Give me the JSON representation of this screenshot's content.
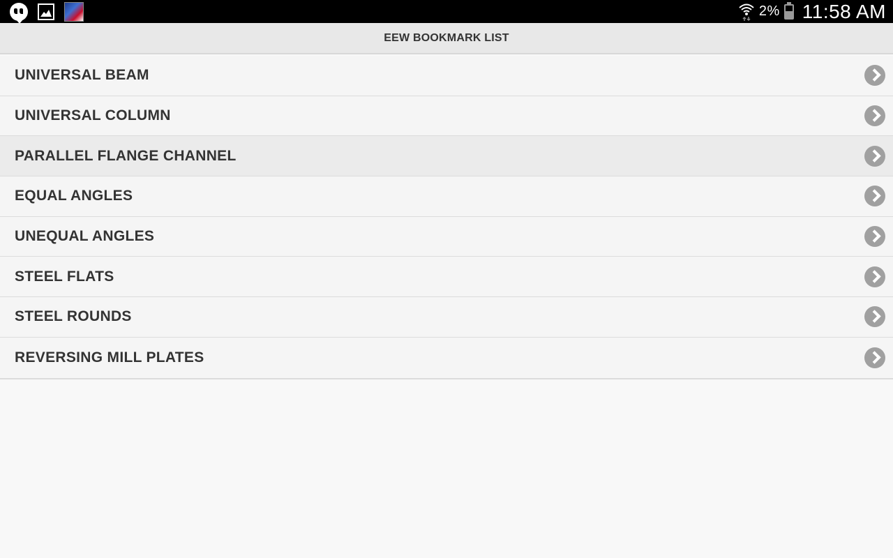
{
  "status_bar": {
    "left_icons": [
      "hangouts-icon",
      "gallery-icon",
      "app-thumbnail-icon"
    ],
    "right_icons": [
      "wifi-icon",
      "battery-icon"
    ],
    "battery_percent": "2%",
    "time": "11:58 AM"
  },
  "header": {
    "title": "EEW BOOKMARK LIST"
  },
  "bookmarks": {
    "items": [
      {
        "label": "UNIVERSAL BEAM"
      },
      {
        "label": "UNIVERSAL COLUMN"
      },
      {
        "label": "PARALLEL FLANGE CHANNEL"
      },
      {
        "label": "EQUAL ANGLES"
      },
      {
        "label": "UNEQUAL ANGLES"
      },
      {
        "label": "STEEL FLATS"
      },
      {
        "label": "STEEL ROUNDS"
      },
      {
        "label": "REVERSING MILL PLATES"
      }
    ],
    "chevron_icon": "chevron-right-icon"
  },
  "colors": {
    "status_bar": "#000000",
    "title_bar": "#e8e8e8",
    "list_background": "#f5f5f5",
    "text": "#333333",
    "chevron": "#a0a0a0"
  }
}
